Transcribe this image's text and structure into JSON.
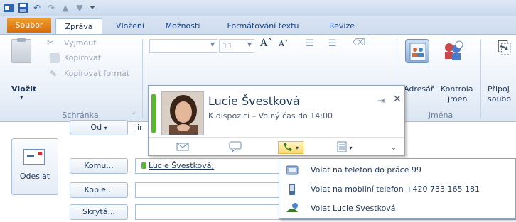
{
  "tabs": [
    "Soubor",
    "Zpráva",
    "Vložení",
    "Možnosti",
    "Formátování textu",
    "Revize"
  ],
  "ribbon": {
    "clipboard": {
      "paste": "Vložit",
      "cut": "Vyjmout",
      "copy": "Kopírovat",
      "format_painter": "Kopírovat formát",
      "group_label": "Schránka"
    },
    "basic_text": {
      "font_size": "11"
    },
    "names": {
      "address_book": "Adresář",
      "check_names_line1": "Kontrola",
      "check_names_line2": "jmen",
      "group_label": "Jména"
    },
    "include": {
      "attach_line1": "Připoj",
      "attach_line2": "soubo"
    }
  },
  "compose": {
    "send": "Odeslat",
    "from": "Od",
    "from_value": "jir",
    "to": "Komu...",
    "cc": "Kopie...",
    "bcc": "Skrytá...",
    "to_value": "Lucie Švestková;"
  },
  "contact_card": {
    "name": "Lucie Švestková",
    "status": "K dispozici – Volný čas do 14:00",
    "presence_color": "#58b82c"
  },
  "call_menu": [
    {
      "label": "Volat na telefon do práce 99",
      "icon": "work-phone-icon"
    },
    {
      "label": "Volat na mobilní telefon +420 733 165 181",
      "icon": "mobile-phone-icon"
    },
    {
      "label": "Volat Lucie Švestková",
      "icon": "call-person-icon"
    }
  ]
}
